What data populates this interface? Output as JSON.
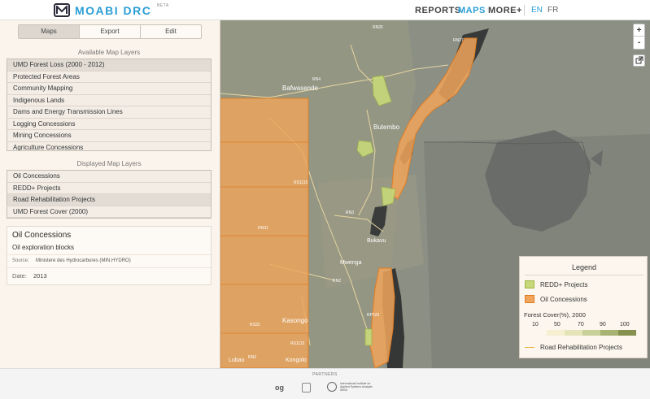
{
  "header": {
    "logo_text": "MOABI DRC",
    "logo_badge": "BETA",
    "nav": [
      "REPORTS",
      "MAPS",
      "MORE+"
    ],
    "lang": [
      "EN",
      "FR"
    ]
  },
  "sidebar": {
    "tabs": [
      "Maps",
      "Export",
      "Edit"
    ],
    "available_title": "Available Map Layers",
    "available_layers": [
      "UMD Forest Loss (2000 - 2012)",
      "Protected Forest Areas",
      "Community Mapping",
      "Indigenous Lands",
      "Dams and Energy Transmission Lines",
      "Logging Concessions",
      "Mining Concessions",
      "Agriculture Concessions"
    ],
    "displayed_title": "Displayed Map Layers",
    "displayed_layers": [
      "Oil Concessions",
      "REDD+ Projects",
      "Road Rehabilitation Projects",
      "UMD Forest Cover (2000)"
    ],
    "info": {
      "title": "Oil Concessions",
      "subtitle": "Oil exploration blocks",
      "source_label": "Source:",
      "source_value": "Ministere des Hydrocarbures (MIN.HYDRO)",
      "date_label": "Date:",
      "date_value": "2013"
    }
  },
  "map": {
    "labels": [
      "RN26",
      "RN27",
      "RN4",
      "Bafwasende",
      "Butembo",
      "RS1115",
      "RN3",
      "RN31",
      "Bukavu",
      "Mwenga",
      "RN2",
      "Kasongo",
      "RS32",
      "RP523",
      "RS1115",
      "RN2",
      "Kongolo",
      "Lubao"
    ],
    "controls": {
      "zoom_in": "+",
      "zoom_out": "-"
    }
  },
  "legend": {
    "title": "Legend",
    "redd_label": "REDD+ Projects",
    "oil_label": "Oil Concessions",
    "forest_title": "Forest Cover(%), 2000",
    "forest_ticks": [
      "10",
      "50",
      "70",
      "90",
      "100"
    ],
    "road_label": "Road Rehabilitation Projects",
    "colors": {
      "redd": "#c6d87a",
      "oil": "#f0a55a",
      "road": "#e6b23a",
      "forest_ramp": [
        "#f6efd2",
        "#e5e3b8",
        "#c9cf98",
        "#a8b273",
        "#86904f"
      ]
    }
  },
  "footer": {
    "partners": "PARTNERS",
    "p1": "og",
    "p3": "International Institute for Applied Systems Analysis",
    "p3_short": "IIASA"
  }
}
